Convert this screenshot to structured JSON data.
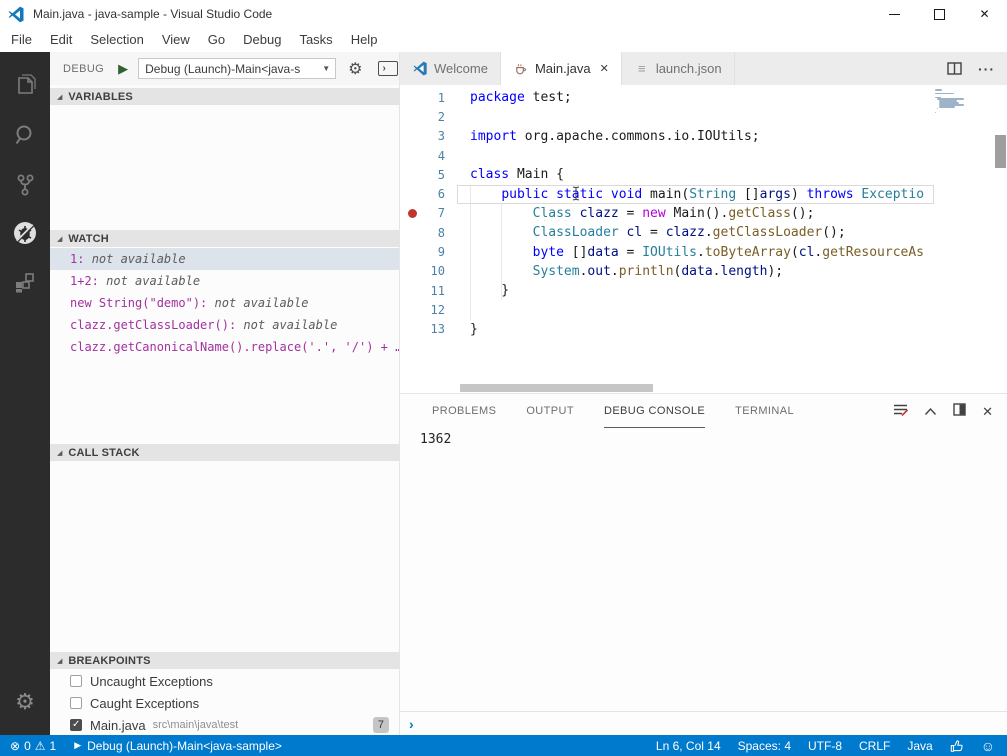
{
  "window": {
    "title": "Main.java - java-sample - Visual Studio Code"
  },
  "menu": {
    "items": [
      "File",
      "Edit",
      "Selection",
      "View",
      "Go",
      "Debug",
      "Tasks",
      "Help"
    ]
  },
  "activity_bar": {
    "items": [
      "files-icon",
      "search-icon",
      "source-control-icon",
      "debug-icon",
      "extensions-icon"
    ],
    "bottom": "settings-gear-icon",
    "active_item": "debug-icon"
  },
  "debug_toolbar": {
    "label": "DEBUG",
    "config": "Debug (Launch)-Main<java-s"
  },
  "variables": {
    "title": "VARIABLES"
  },
  "watch": {
    "title": "WATCH",
    "items": [
      {
        "expr": "1: ",
        "value": "not available",
        "selected": true
      },
      {
        "expr": "1+2: ",
        "value": "not available",
        "selected": false
      },
      {
        "expr": "new String(\"demo\"): ",
        "value": "not available",
        "selected": false
      },
      {
        "expr": "clazz.getClassLoader(): ",
        "value": "not available",
        "selected": false
      },
      {
        "expr": "clazz.getCanonicalName().replace('.', '/') + …",
        "value": "",
        "selected": false
      }
    ]
  },
  "call_stack": {
    "title": "CALL STACK"
  },
  "breakpoints": {
    "title": "BREAKPOINTS",
    "items": [
      {
        "checked": false,
        "label": "Uncaught Exceptions",
        "path": "",
        "badge": ""
      },
      {
        "checked": false,
        "label": "Caught Exceptions",
        "path": "",
        "badge": ""
      },
      {
        "checked": true,
        "label": "Main.java",
        "path": "src\\main\\java\\test",
        "badge": "7"
      }
    ]
  },
  "tabs": [
    {
      "label": "Welcome",
      "icon": "vscode-logo-icon",
      "active": false
    },
    {
      "label": "Main.java",
      "icon": "java-icon",
      "active": true
    },
    {
      "label": "launch.json",
      "icon": "json-lines-icon",
      "active": false
    }
  ],
  "editor": {
    "breakpoint_line": 7,
    "current_line": 6,
    "lines": [
      {
        "n": 1,
        "tokens": [
          {
            "c": "kw",
            "t": "package"
          },
          {
            "c": "plain",
            "t": " test;"
          }
        ]
      },
      {
        "n": 2,
        "tokens": []
      },
      {
        "n": 3,
        "tokens": [
          {
            "c": "kw",
            "t": "import"
          },
          {
            "c": "plain",
            "t": " org.apache.commons.io.IOUtils;"
          }
        ]
      },
      {
        "n": 4,
        "tokens": []
      },
      {
        "n": 5,
        "tokens": [
          {
            "c": "kw",
            "t": "class"
          },
          {
            "c": "plain",
            "t": " Main {"
          }
        ]
      },
      {
        "n": 6,
        "tokens": [
          {
            "c": "plain",
            "t": "    "
          },
          {
            "c": "kw",
            "t": "public"
          },
          {
            "c": "plain",
            "t": " "
          },
          {
            "c": "kw",
            "t": "static"
          },
          {
            "c": "plain",
            "t": " "
          },
          {
            "c": "kw",
            "t": "void"
          },
          {
            "c": "plain",
            "t": " main("
          },
          {
            "c": "type",
            "t": "String"
          },
          {
            "c": "plain",
            "t": " []"
          },
          {
            "c": "var",
            "t": "args"
          },
          {
            "c": "plain",
            "t": ") "
          },
          {
            "c": "kw",
            "t": "throws"
          },
          {
            "c": "plain",
            "t": " "
          },
          {
            "c": "type",
            "t": "Exceptio"
          }
        ]
      },
      {
        "n": 7,
        "tokens": [
          {
            "c": "plain",
            "t": "        "
          },
          {
            "c": "type",
            "t": "Class",
            "u": true
          },
          {
            "c": "plain",
            "t": " "
          },
          {
            "c": "var",
            "t": "clazz"
          },
          {
            "c": "plain",
            "t": " = "
          },
          {
            "c": "new",
            "t": "new"
          },
          {
            "c": "plain",
            "t": " Main()."
          },
          {
            "c": "method",
            "t": "getClass"
          },
          {
            "c": "plain",
            "t": "();"
          }
        ]
      },
      {
        "n": 8,
        "tokens": [
          {
            "c": "plain",
            "t": "        "
          },
          {
            "c": "type",
            "t": "ClassLoader"
          },
          {
            "c": "plain",
            "t": " "
          },
          {
            "c": "var",
            "t": "cl"
          },
          {
            "c": "plain",
            "t": " = "
          },
          {
            "c": "var",
            "t": "clazz"
          },
          {
            "c": "plain",
            "t": "."
          },
          {
            "c": "method",
            "t": "getClassLoader"
          },
          {
            "c": "plain",
            "t": "();"
          }
        ]
      },
      {
        "n": 9,
        "tokens": [
          {
            "c": "plain",
            "t": "        "
          },
          {
            "c": "kw",
            "t": "byte"
          },
          {
            "c": "plain",
            "t": " []"
          },
          {
            "c": "var",
            "t": "data"
          },
          {
            "c": "plain",
            "t": " = "
          },
          {
            "c": "type",
            "t": "IOUtils"
          },
          {
            "c": "plain",
            "t": "."
          },
          {
            "c": "method",
            "t": "toByteArray"
          },
          {
            "c": "plain",
            "t": "("
          },
          {
            "c": "var",
            "t": "cl"
          },
          {
            "c": "plain",
            "t": "."
          },
          {
            "c": "method",
            "t": "getResourceAs"
          }
        ]
      },
      {
        "n": 10,
        "tokens": [
          {
            "c": "plain",
            "t": "        "
          },
          {
            "c": "type",
            "t": "System"
          },
          {
            "c": "plain",
            "t": "."
          },
          {
            "c": "var",
            "t": "out"
          },
          {
            "c": "plain",
            "t": "."
          },
          {
            "c": "method",
            "t": "println"
          },
          {
            "c": "plain",
            "t": "("
          },
          {
            "c": "var",
            "t": "data"
          },
          {
            "c": "plain",
            "t": "."
          },
          {
            "c": "var",
            "t": "length"
          },
          {
            "c": "plain",
            "t": ");"
          }
        ]
      },
      {
        "n": 11,
        "tokens": [
          {
            "c": "plain",
            "t": "    }"
          }
        ]
      },
      {
        "n": 12,
        "tokens": []
      },
      {
        "n": 13,
        "tokens": [
          {
            "c": "plain",
            "t": "}"
          }
        ]
      }
    ]
  },
  "panel": {
    "tabs": [
      {
        "label": "PROBLEMS",
        "active": false
      },
      {
        "label": "OUTPUT",
        "active": false
      },
      {
        "label": "DEBUG CONSOLE",
        "active": true
      },
      {
        "label": "TERMINAL",
        "active": false
      }
    ],
    "output": "1362",
    "prompt": "›"
  },
  "status_bar": {
    "errors": "0",
    "warnings": "1",
    "debug_target": "Debug (Launch)-Main<java-sample>",
    "right_items": [
      {
        "name": "cursor-position",
        "text": "Ln 6, Col 14"
      },
      {
        "name": "indentation",
        "text": "Spaces: 4"
      },
      {
        "name": "encoding",
        "text": "UTF-8"
      },
      {
        "name": "eol",
        "text": "CRLF"
      },
      {
        "name": "language-mode",
        "text": "Java"
      }
    ]
  },
  "colors": {
    "statusbar": "#007acc",
    "activitybar": "#2c2c2c",
    "breakpoint": "#c0362c",
    "selection_row": "#dce3ea",
    "keyword": "#0000ff",
    "type": "#267f99",
    "method": "#795e26",
    "variable": "#001080",
    "new_keyword": "#af00db",
    "watch_expr": "#a2319f"
  }
}
